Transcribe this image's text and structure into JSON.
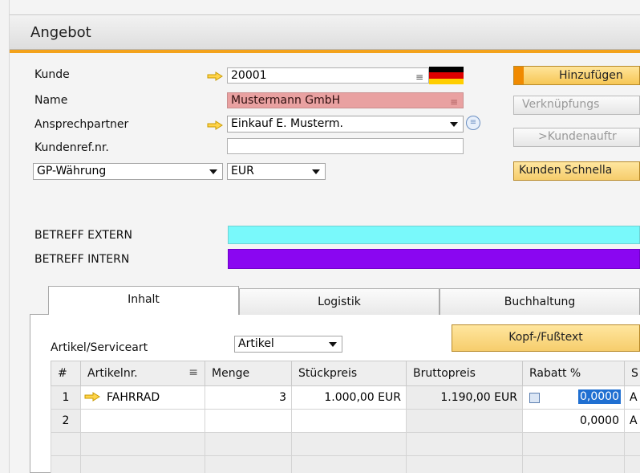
{
  "window": {
    "title": "Angebot"
  },
  "header": {
    "kunde_label": "Kunde",
    "kunde_value": "20001",
    "name_label": "Name",
    "name_value": "Mustermann GmbH",
    "ansprech_label": "Ansprechpartner",
    "ansprech_value": "Einkauf E. Musterm.",
    "kundenref_label": "Kundenref.nr.",
    "kundenref_value": "",
    "waehrung_select": "GP-Währung",
    "waehrung_value": "EUR"
  },
  "buttons": {
    "hinzufuegen": "Hinzufügen",
    "verknuepfungs": "Verknüpfungs",
    "kundenauftrag": ">Kundenauftr",
    "schnellanlage": "Kunden Schnella"
  },
  "betreff": {
    "extern_label": "BETREFF EXTERN",
    "extern_color": "#79f9fb",
    "intern_label": "BETREFF INTERN",
    "intern_color": "#8a06f1"
  },
  "tabs": [
    {
      "label": "Inhalt"
    },
    {
      "label": "Logistik"
    },
    {
      "label": "Buchhaltung"
    }
  ],
  "content": {
    "artikel_label": "Artikel/Serviceart",
    "artikel_type": "Artikel",
    "kopf_button": "Kopf-/Fußtext"
  },
  "table": {
    "columns": [
      "#",
      "Artikelnr.",
      "Menge",
      "Stückpreis",
      "Bruttopreis",
      "Rabatt %",
      "S"
    ],
    "rows": [
      {
        "num": "1",
        "artikel": "FAHRRAD",
        "menge": "3",
        "stueckpreis": "1.000,00 EUR",
        "bruttopreis": "1.190,00 EUR",
        "rabatt": "0,0000",
        "s": "A"
      },
      {
        "num": "2",
        "artikel": "",
        "menge": "",
        "stueckpreis": "",
        "bruttopreis": "",
        "rabatt": "0,0000",
        "s": "A"
      }
    ]
  },
  "colors": {
    "accent": "#f3a21b",
    "primary_button": "#f6c655"
  }
}
